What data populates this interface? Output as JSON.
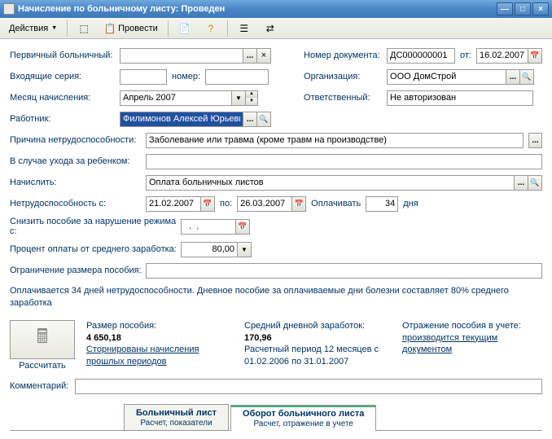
{
  "window": {
    "title": "Начисление по больничному листу: Проведен"
  },
  "toolbar": {
    "actions": "Действия",
    "post": "Провести"
  },
  "labels": {
    "primary": "Первичный больничный:",
    "incoming_series": "Входящие серия:",
    "number": "номер:",
    "calc_month": "Месяц начисления:",
    "employee": "Работник:",
    "doc_number": "Номер документа:",
    "from": "от:",
    "org": "Организация:",
    "responsible": "Ответственный:",
    "reason": "Причина нетрудоспособности:",
    "child_care": "В случае ухода за ребенком:",
    "accrue": "Начислить:",
    "disability_from": "Нетрудоспособность с:",
    "to": "по:",
    "pay_days": "Оплачивать",
    "days": "дня",
    "reduce": "Снизить пособие за нарушение режима с:",
    "percent": "Процент оплаты от среднего заработка:",
    "limit": "Ограничение размера пособия:",
    "comment": "Комментарий:"
  },
  "values": {
    "primary": "",
    "series": "",
    "number": "",
    "month": "Апрель 2007",
    "employee": "Филимонов Алексей Юрьевич",
    "doc_number": "ДС000000001",
    "doc_date": "16.02.2007",
    "org": "ООО ДомСтрой",
    "responsible": "Не авторизован",
    "reason": "Заболевание или травма (кроме травм на производстве)",
    "child_care": "",
    "accrue": "Оплата больничных листов",
    "date_from": "21.02.2007",
    "date_to": "26.03.2007",
    "pay_days": "34",
    "reduce_date": "  .  .",
    "percent": "80,00",
    "limit": "",
    "comment": ""
  },
  "info": "Оплачивается 34 дней нетрудоспособности. Дневное пособие за оплачиваемые дни болезни составляет 80% среднего заработка",
  "calc": {
    "btn": "Рассчитать",
    "size_label": "Размер пособия:",
    "size_value": "4 650,18",
    "storno": "Сторнированы начисления прошлых периодов",
    "avg_label": "Средний дневной заработок:",
    "avg_value": "170,96",
    "period": "Расчетный период 12 месяцев с 01.02.2006 по 31.01.2007",
    "reflect_label": "Отражение пособия в учете:",
    "reflect_value": "производится текущим документом"
  },
  "tabs": {
    "t1": "Больничный лист",
    "t1_sub": "Расчет, показатели",
    "t2": "Оборот больничного листа",
    "t2_sub": "Расчет, отражение в учете"
  }
}
